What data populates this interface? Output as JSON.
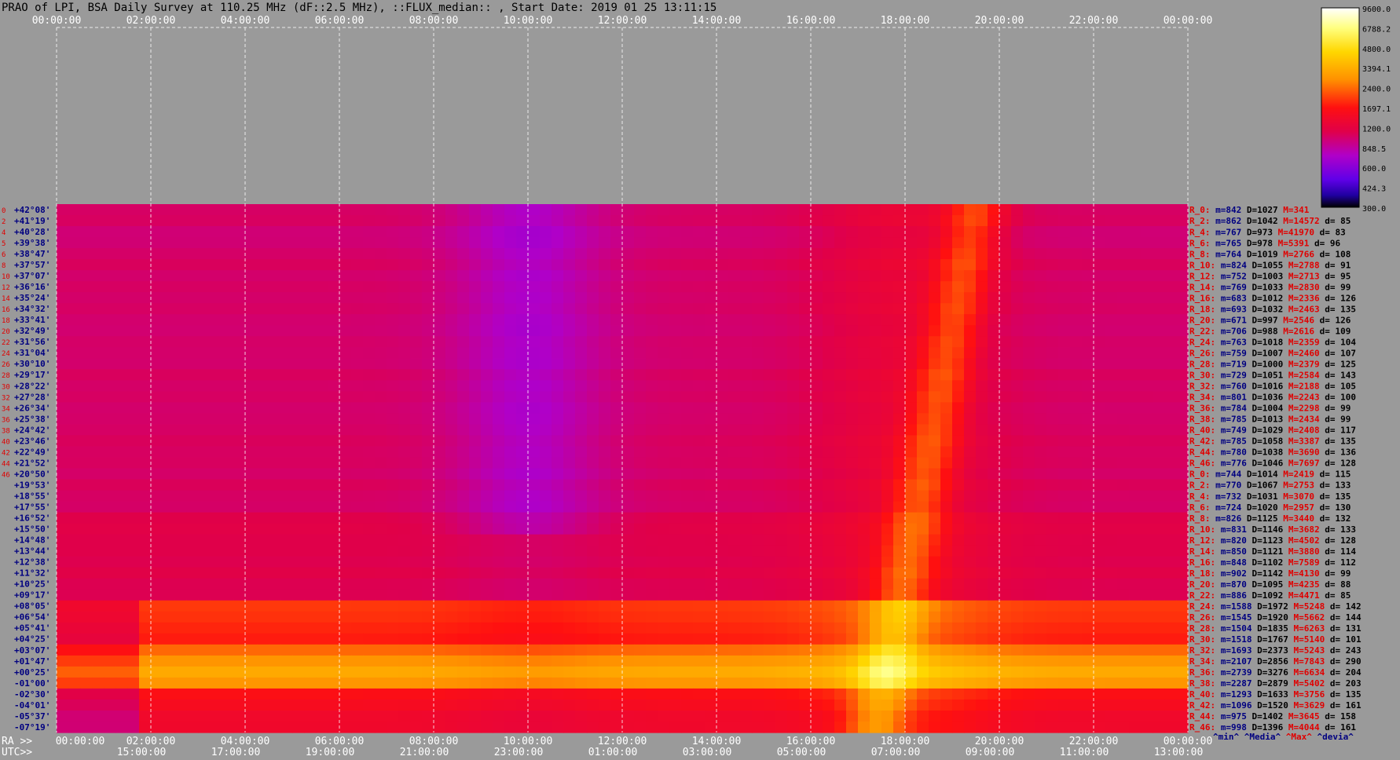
{
  "title": "PRAO of LPI, BSA Daily Survey at 110.25 MHz (dF::2.5 MHz), ::FLUX_median:: , Start Date: 2019 01 25 13:11:15",
  "chart_data": {
    "type": "heatmap",
    "title": "PRAO of LPI, BSA Daily Survey at 110.25 MHz (dF::2.5 MHz), ::FLUX_median:: , Start Date: 2019 01 25 13:11:15",
    "xlabel_ra": "RA >>",
    "xlabel_utc": "UTC>>",
    "ra_ticks": [
      "00:00:00",
      "02:00:00",
      "04:00:00",
      "06:00:00",
      "08:00:00",
      "10:00:00",
      "12:00:00",
      "14:00:00",
      "16:00:00",
      "18:00:00",
      "20:00:00",
      "22:00:00",
      "00:00:00"
    ],
    "utc_ticks": [
      "15:00:00",
      "17:00:00",
      "19:00:00",
      "21:00:00",
      "23:00:00",
      "01:00:00",
      "03:00:00",
      "05:00:00",
      "07:00:00",
      "09:00:00",
      "11:00:00",
      "13:00:00"
    ],
    "colorbar": {
      "ticks": [
        "9600.0",
        "6788.2",
        "4800.0",
        "3394.1",
        "2400.0",
        "1697.1",
        "1200.0",
        "848.5",
        "600.0",
        "424.3",
        "300.0"
      ],
      "range": [
        300.0,
        9600.0
      ],
      "scale": "log"
    },
    "row_numbers_top": [
      "0",
      "2",
      "4",
      "5",
      "6",
      "8",
      "10",
      "12",
      "14",
      "16",
      "18",
      "20",
      "22",
      "24",
      "26",
      "28",
      "30",
      "32",
      "34",
      "36",
      "38",
      "40",
      "42",
      "44",
      "46"
    ],
    "rows": [
      {
        "dec": "+42°08'",
        "label": "R_0:",
        "m": "842",
        "D": "1027",
        "M": "341",
        "d": ""
      },
      {
        "dec": "+41°19'",
        "label": "R_2:",
        "m": "862",
        "D": "1042",
        "M": "14572",
        "d": "85"
      },
      {
        "dec": "+40°28'",
        "label": "R_4:",
        "m": "767",
        "D": "973",
        "M": "41970",
        "d": "83"
      },
      {
        "dec": "+39°38'",
        "label": "R_6:",
        "m": "765",
        "D": "978",
        "M": "5391",
        "d": "96"
      },
      {
        "dec": "+38°47'",
        "label": "R_8:",
        "m": "764",
        "D": "1019",
        "M": "2766",
        "d": "108"
      },
      {
        "dec": "+37°57'",
        "label": "R_10:",
        "m": "824",
        "D": "1055",
        "M": "2788",
        "d": "91"
      },
      {
        "dec": "+37°07'",
        "label": "R_12:",
        "m": "752",
        "D": "1003",
        "M": "2713",
        "d": "95"
      },
      {
        "dec": "+36°16'",
        "label": "R_14:",
        "m": "769",
        "D": "1033",
        "M": "2830",
        "d": "99"
      },
      {
        "dec": "+35°24'",
        "label": "R_16:",
        "m": "683",
        "D": "1012",
        "M": "2336",
        "d": "126"
      },
      {
        "dec": "+34°32'",
        "label": "R_18:",
        "m": "693",
        "D": "1032",
        "M": "2463",
        "d": "135"
      },
      {
        "dec": "+33°41'",
        "label": "R_20:",
        "m": "671",
        "D": "997",
        "M": "2546",
        "d": "126"
      },
      {
        "dec": "+32°49'",
        "label": "R_22:",
        "m": "706",
        "D": "988",
        "M": "2616",
        "d": "109"
      },
      {
        "dec": "+31°56'",
        "label": "R_24:",
        "m": "763",
        "D": "1018",
        "M": "2359",
        "d": "104"
      },
      {
        "dec": "+31°04'",
        "label": "R_26:",
        "m": "759",
        "D": "1007",
        "M": "2460",
        "d": "107"
      },
      {
        "dec": "+30°10'",
        "label": "R_28:",
        "m": "719",
        "D": "1000",
        "M": "2379",
        "d": "125"
      },
      {
        "dec": "+29°17'",
        "label": "R_30:",
        "m": "729",
        "D": "1051",
        "M": "2584",
        "d": "143"
      },
      {
        "dec": "+28°22'",
        "label": "R_32:",
        "m": "760",
        "D": "1016",
        "M": "2188",
        "d": "105"
      },
      {
        "dec": "+27°28'",
        "label": "R_34:",
        "m": "801",
        "D": "1036",
        "M": "2243",
        "d": "100"
      },
      {
        "dec": "+26°34'",
        "label": "R_36:",
        "m": "784",
        "D": "1004",
        "M": "2298",
        "d": "99"
      },
      {
        "dec": "+25°38'",
        "label": "R_38:",
        "m": "785",
        "D": "1013",
        "M": "2434",
        "d": "99"
      },
      {
        "dec": "+24°42'",
        "label": "R_40:",
        "m": "749",
        "D": "1029",
        "M": "2408",
        "d": "117"
      },
      {
        "dec": "+23°46'",
        "label": "R_42:",
        "m": "785",
        "D": "1058",
        "M": "3387",
        "d": "135"
      },
      {
        "dec": "+22°49'",
        "label": "R_44:",
        "m": "780",
        "D": "1038",
        "M": "3690",
        "d": "136"
      },
      {
        "dec": "+21°52'",
        "label": "R_46:",
        "m": "776",
        "D": "1046",
        "M": "7697",
        "d": "128"
      },
      {
        "dec": "+20°50'",
        "label": "R_0:",
        "m": "744",
        "D": "1014",
        "M": "2419",
        "d": "115"
      },
      {
        "dec": "+19°53'",
        "label": "R_2:",
        "m": "770",
        "D": "1067",
        "M": "2753",
        "d": "133"
      },
      {
        "dec": "+18°55'",
        "label": "R_4:",
        "m": "732",
        "D": "1031",
        "M": "3070",
        "d": "135"
      },
      {
        "dec": "+17°55'",
        "label": "R_6:",
        "m": "724",
        "D": "1020",
        "M": "2957",
        "d": "130"
      },
      {
        "dec": "+16°52'",
        "label": "R_8:",
        "m": "826",
        "D": "1125",
        "M": "3440",
        "d": "132"
      },
      {
        "dec": "+15°50'",
        "label": "R_10:",
        "m": "831",
        "D": "1146",
        "M": "3682",
        "d": "133"
      },
      {
        "dec": "+14°48'",
        "label": "R_12:",
        "m": "820",
        "D": "1123",
        "M": "4502",
        "d": "128"
      },
      {
        "dec": "+13°44'",
        "label": "R_14:",
        "m": "850",
        "D": "1121",
        "M": "3880",
        "d": "114"
      },
      {
        "dec": "+12°38'",
        "label": "R_16:",
        "m": "848",
        "D": "1102",
        "M": "7589",
        "d": "112"
      },
      {
        "dec": "+11°32'",
        "label": "R_18:",
        "m": "902",
        "D": "1142",
        "M": "4130",
        "d": "99"
      },
      {
        "dec": "+10°25'",
        "label": "R_20:",
        "m": "870",
        "D": "1095",
        "M": "4235",
        "d": "88"
      },
      {
        "dec": "+09°17'",
        "label": "R_22:",
        "m": "886",
        "D": "1092",
        "M": "4471",
        "d": "85"
      },
      {
        "dec": "+08°05'",
        "label": "R_24:",
        "m": "1588",
        "D": "1972",
        "M": "5248",
        "d": "142"
      },
      {
        "dec": "+06°54'",
        "label": "R_26:",
        "m": "1545",
        "D": "1920",
        "M": "5662",
        "d": "144"
      },
      {
        "dec": "+05°41'",
        "label": "R_28:",
        "m": "1504",
        "D": "1835",
        "M": "6263",
        "d": "131"
      },
      {
        "dec": "+04°25'",
        "label": "R_30:",
        "m": "1518",
        "D": "1767",
        "M": "5140",
        "d": "101"
      },
      {
        "dec": "+03°07'",
        "label": "R_32:",
        "m": "1693",
        "D": "2373",
        "M": "5243",
        "d": "243"
      },
      {
        "dec": "+01°47'",
        "label": "R_34:",
        "m": "2107",
        "D": "2856",
        "M": "7843",
        "d": "290"
      },
      {
        "dec": "+00°25'",
        "label": "R_36:",
        "m": "2739",
        "D": "3276",
        "M": "6634",
        "d": "204"
      },
      {
        "dec": "-01°00'",
        "label": "R_38:",
        "m": "2287",
        "D": "2879",
        "M": "5402",
        "d": "203"
      },
      {
        "dec": "-02°30'",
        "label": "R_40:",
        "m": "1293",
        "D": "1633",
        "M": "3756",
        "d": "135"
      },
      {
        "dec": "-04°01'",
        "label": "R_42:",
        "m": "1096",
        "D": "1520",
        "M": "3629",
        "d": "161"
      },
      {
        "dec": "-05°37'",
        "label": "R_44:",
        "m": "975",
        "D": "1402",
        "M": "3645",
        "d": "158"
      },
      {
        "dec": "-07°19'",
        "label": "R_46:",
        "m": "998",
        "D": "1396",
        "M": "4044",
        "d": "161"
      }
    ],
    "legend_footer": [
      "^min^",
      "^Media^",
      "^Max^",
      "^devia^"
    ],
    "grid": true
  },
  "colors": {
    "background": "#9a9a9a",
    "label_blue": "#000080",
    "label_red": "#e00000",
    "grid_line": "#ffffff"
  }
}
